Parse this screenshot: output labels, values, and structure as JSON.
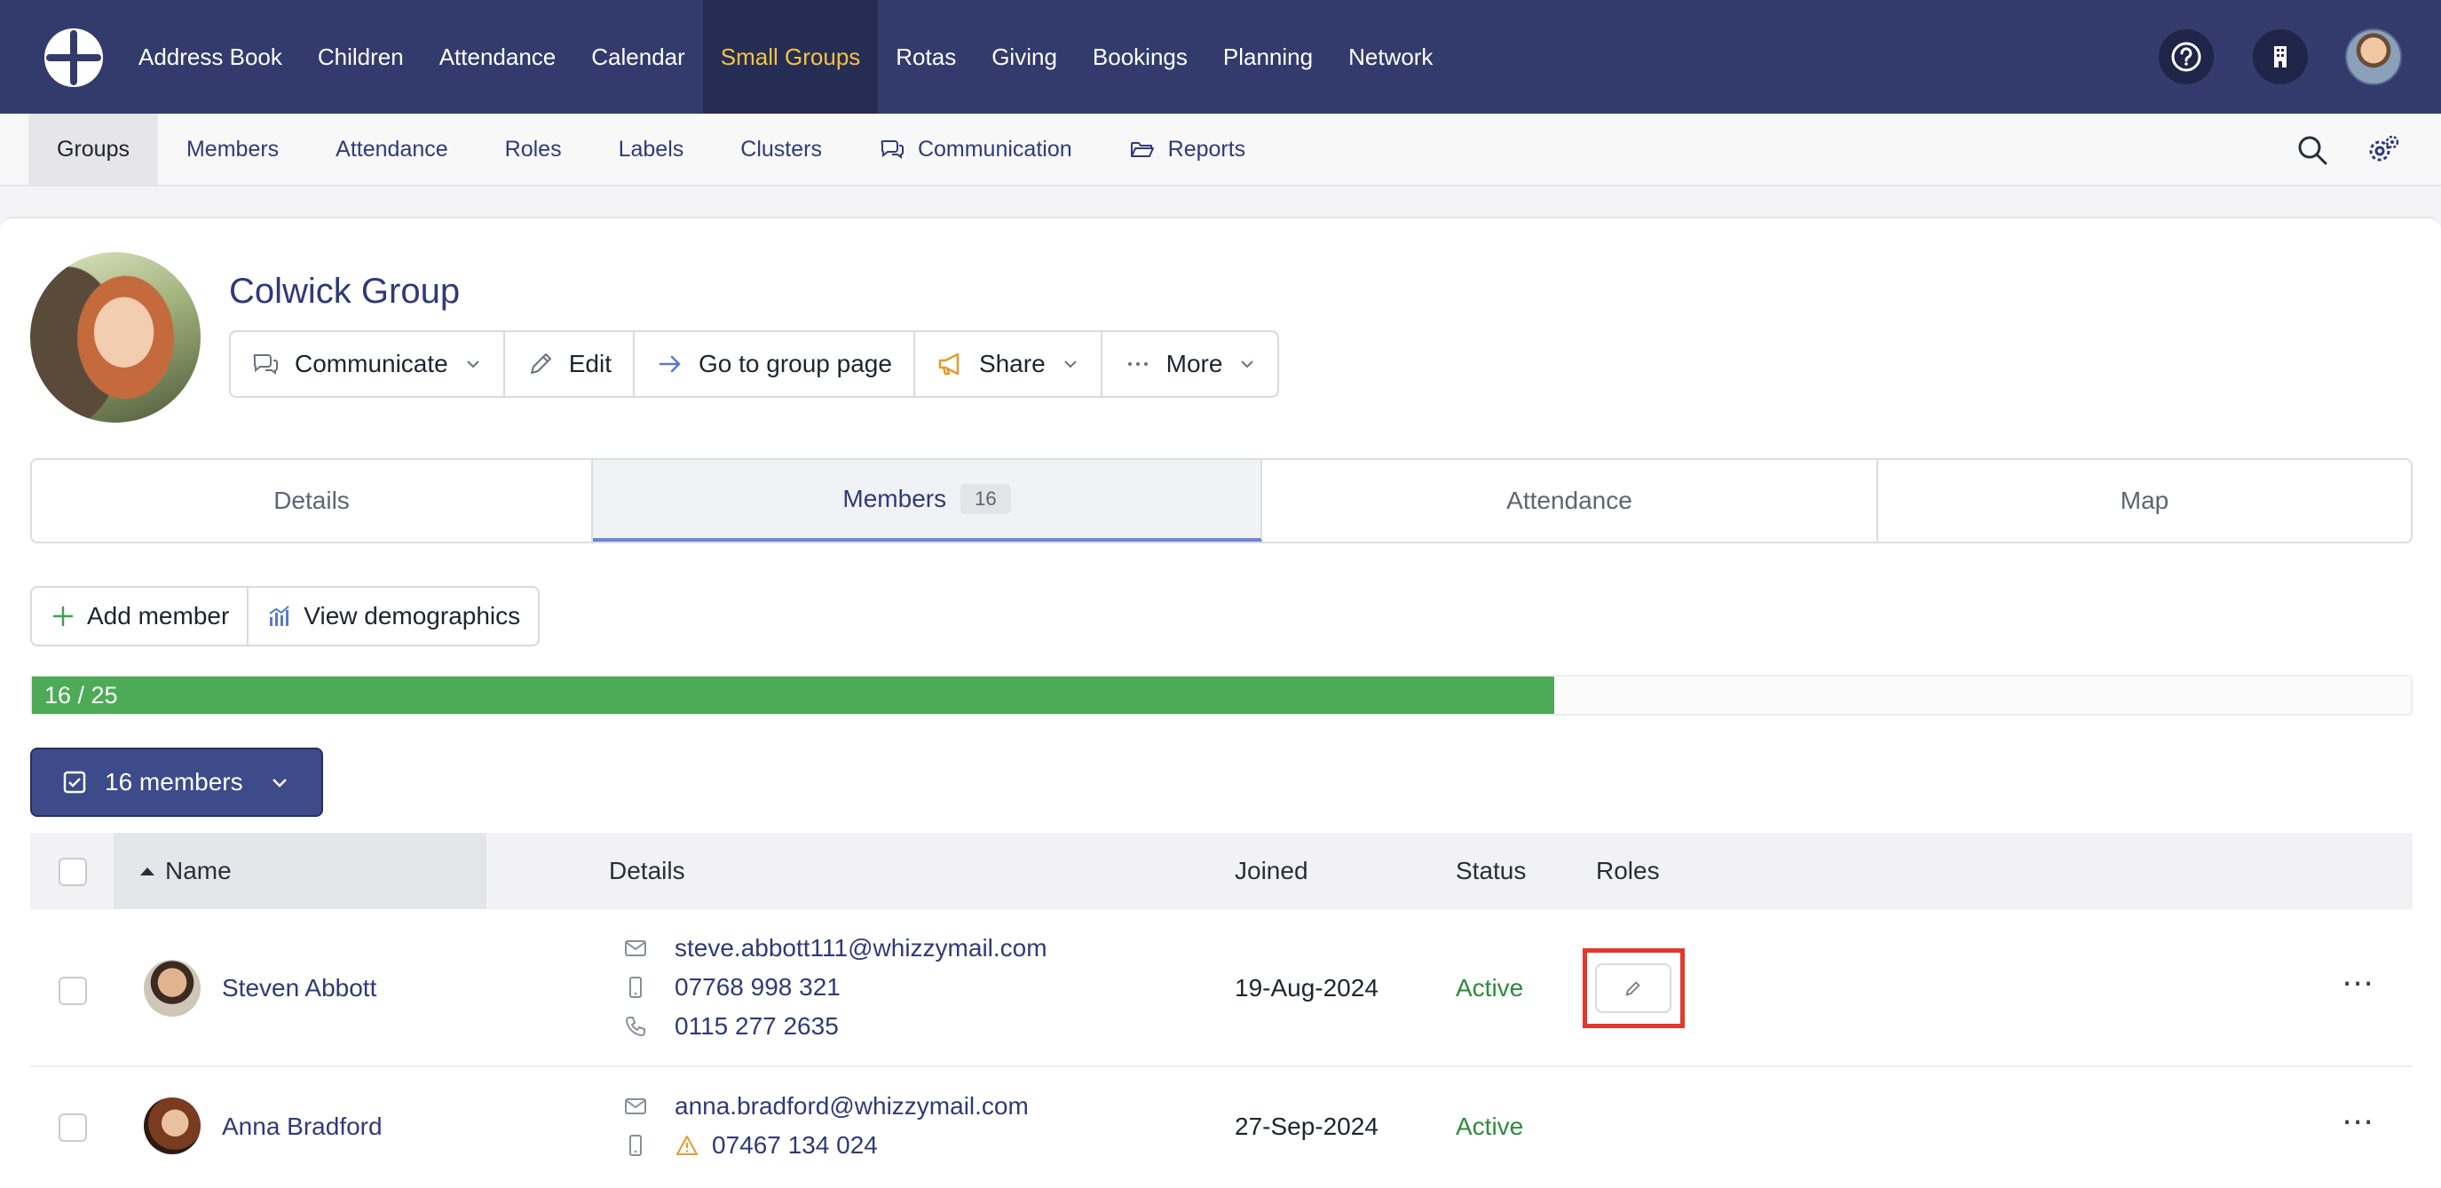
{
  "topnav": {
    "items": [
      "Address Book",
      "Children",
      "Attendance",
      "Calendar",
      "Small Groups",
      "Rotas",
      "Giving",
      "Bookings",
      "Planning",
      "Network"
    ],
    "active": "Small Groups"
  },
  "subnav": {
    "items": [
      "Groups",
      "Members",
      "Attendance",
      "Roles",
      "Labels",
      "Clusters",
      "Communication",
      "Reports"
    ],
    "active": "Groups"
  },
  "group": {
    "title": "Colwick Group",
    "actions": {
      "communicate": "Communicate",
      "edit": "Edit",
      "go_to_page": "Go to group page",
      "share": "Share",
      "more": "More"
    }
  },
  "tabs": {
    "details": "Details",
    "members": "Members",
    "members_count": "16",
    "attendance": "Attendance",
    "map": "Map"
  },
  "member_actions": {
    "add_member": "Add member",
    "view_demographics": "View demographics"
  },
  "capacity": {
    "label": "16 / 25",
    "current": 16,
    "max": 25
  },
  "members_dropdown": "16 members",
  "table": {
    "headers": {
      "name": "Name",
      "details": "Details",
      "joined": "Joined",
      "status": "Status",
      "roles": "Roles"
    },
    "rows": [
      {
        "name": "Steven Abbott",
        "email": "steve.abbott111@whizzymail.com",
        "mobile": "07768 998 321",
        "phone": "0115 277 2635",
        "joined": "19-Aug-2024",
        "status": "Active"
      },
      {
        "name": "Anna Bradford",
        "email": "anna.bradford@whizzymail.com",
        "mobile": "07467 134 024",
        "joined": "27-Sep-2024",
        "status": "Active"
      }
    ]
  },
  "colors": {
    "nav_bg": "#323b6c",
    "nav_active": "#f5c342",
    "link": "#2f3a78",
    "capacity_fill": "#4daa57",
    "status_active": "#2f8a3a",
    "highlight": "#e1392b"
  },
  "icons": {
    "logo": "church-cross-logo",
    "help": "question-circle-icon",
    "building": "building-icon",
    "search": "search-icon",
    "settings": "gears-icon"
  }
}
